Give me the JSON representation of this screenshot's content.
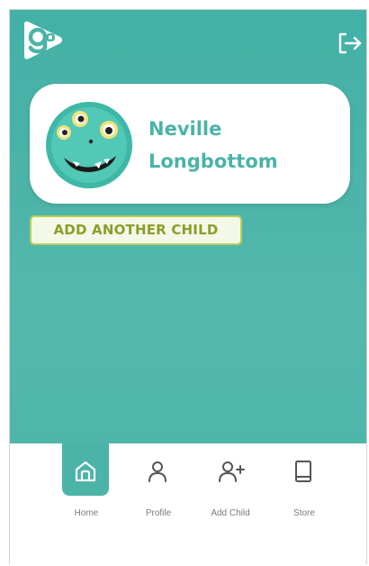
{
  "header": {
    "logo_icon": "ginger-logo-icon",
    "logout_icon": "logout-icon"
  },
  "child_card": {
    "first_name": "Neville",
    "last_name": "Longbottom",
    "avatar_icon": "green-monster-avatar"
  },
  "actions": {
    "add_child_label": "ADD ANOTHER CHILD"
  },
  "bottom_nav": {
    "items": [
      {
        "label": "Home",
        "icon": "home-icon",
        "active": true
      },
      {
        "label": "Profile",
        "icon": "profile-icon",
        "active": false
      },
      {
        "label": "Add Child",
        "icon": "add-user-icon",
        "active": false
      },
      {
        "label": "Store",
        "icon": "book-icon",
        "active": false
      }
    ]
  },
  "colors": {
    "primary": "#4bb3a8",
    "accent": "#b8cf55",
    "accent_text": "#8a9e2b",
    "nav_label": "#7a7a7a"
  }
}
